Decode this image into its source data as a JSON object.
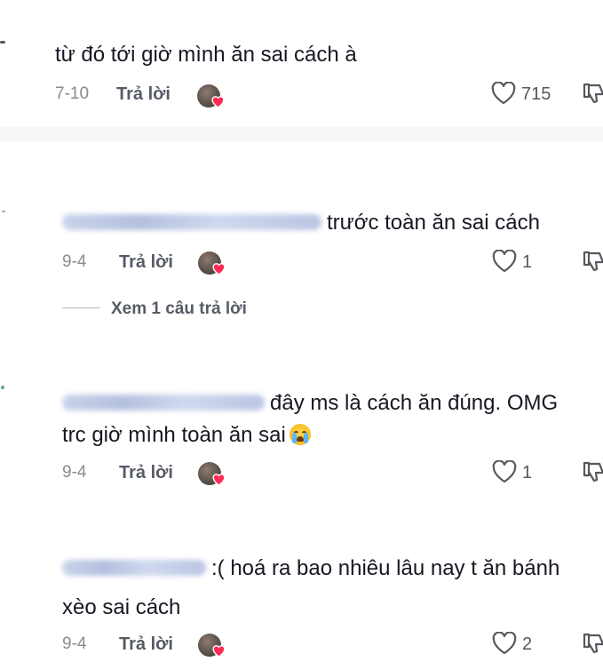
{
  "comments": [
    {
      "text": "từ đó tới giờ mình ăn sai cách à",
      "date": "7-10",
      "reply_label": "Trả lời",
      "like_count": "715"
    },
    {
      "text": "trước toàn ăn sai cách",
      "date": "9-4",
      "reply_label": "Trả lời",
      "like_count": "1"
    },
    {
      "text_line1": "đây ms là cách ăn đúng. OMG",
      "text_line2": "trc giờ mình toàn ăn sai",
      "date": "9-4",
      "reply_label": "Trả lời",
      "like_count": "1"
    },
    {
      "text_line1": ":( hoá ra bao nhiêu lâu nay t ăn bánh",
      "text_line2": "xèo sai cách",
      "date": "9-4",
      "reply_label": "Trả lời",
      "like_count": "2"
    }
  ],
  "view_replies": "Xem 1 câu trả lời",
  "icons": {
    "like": "heart-outline-icon",
    "dislike": "thumbs-down-icon",
    "creator_liked": "creator-liked-heart-icon",
    "emoji": "loudly-crying-face-emoji"
  },
  "colors": {
    "text": "#161823",
    "meta": "#8a8b91",
    "heart_badge": "#fe2c55",
    "divider": "#f7f7f8"
  }
}
